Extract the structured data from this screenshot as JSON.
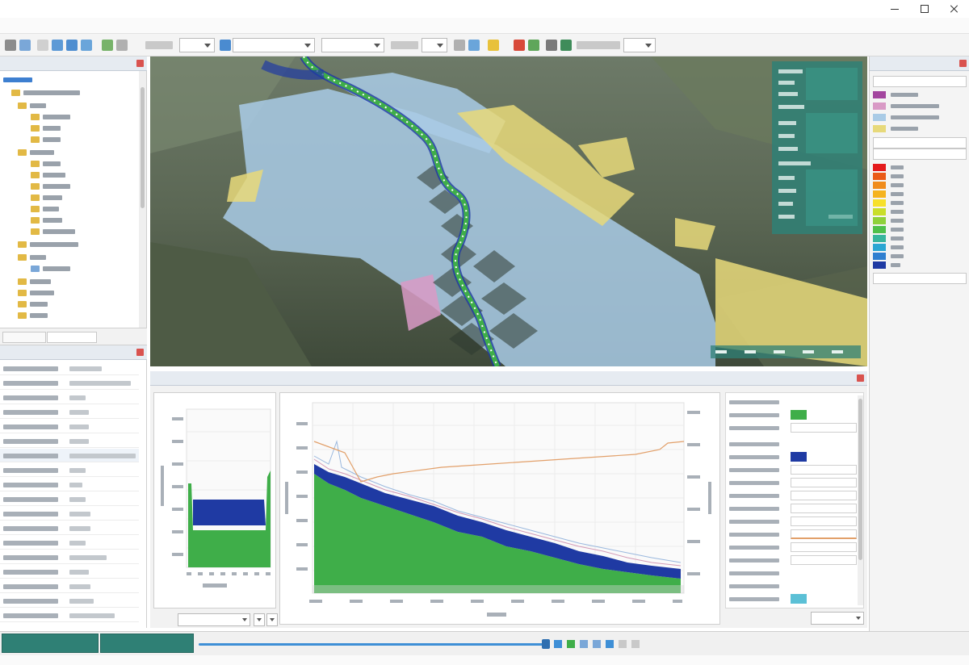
{
  "window": {
    "title": ""
  },
  "menu": {
    "items": [
      "",
      "",
      "",
      "",
      "",
      "",
      "",
      "",
      "",
      ""
    ]
  },
  "colors": {
    "accent_teal": "#2f8075",
    "water_deep": "#1f3aa3",
    "ground_green": "#3fae49",
    "flood_light_blue": "#a9cbe6",
    "flood_yellow": "#e7d97a",
    "flood_pink": "#d99ac6",
    "slider_blue": "#3e8fd6"
  },
  "icons": {
    "toolbar": [
      "open-icon",
      "save-icon",
      "select-icon",
      "pan-icon",
      "zoom-icon",
      "ruler-icon",
      "layer-icon",
      "bookmark-icon",
      "warning-icon",
      "pin-icon",
      "print-icon",
      "export-icon"
    ]
  },
  "legend": {
    "depth_colors": [
      "#e41a1c",
      "#ea5a17",
      "#f08c1c",
      "#f5b31e",
      "#f7e02b",
      "#c9de2a",
      "#8fd13a",
      "#4fc04a",
      "#37b59d",
      "#2aa6d3",
      "#2f7fd0",
      "#1f3aa3"
    ],
    "category_colors": [
      "#a3469f",
      "#d99ac6",
      "#a9cbe6",
      "#e7d97a"
    ]
  },
  "cross_section": {
    "water_level_fraction": 0.62,
    "bed_level_fraction": 0.28
  },
  "timeline": {
    "playback_position_fraction": 0.99
  }
}
